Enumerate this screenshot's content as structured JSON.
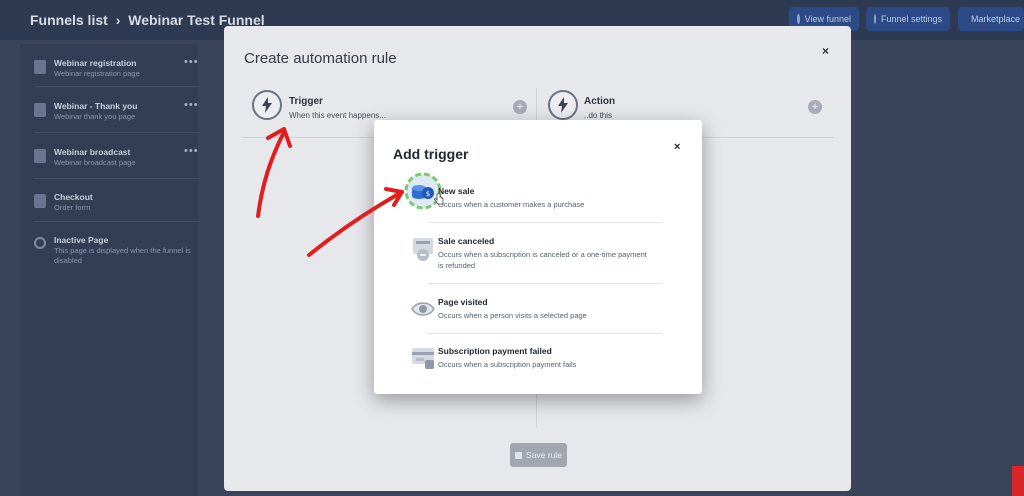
{
  "header": {
    "breadcrumb_root": "Funnels list",
    "separator": "›",
    "breadcrumb_current": "Webinar Test Funnel",
    "buttons": [
      {
        "label": "View funnel",
        "icon": "eye-icon"
      },
      {
        "label": "Funnel settings",
        "icon": "gear-icon"
      },
      {
        "label": "Marketplace",
        "icon": "store-icon"
      }
    ]
  },
  "sidebar": {
    "items": [
      {
        "title": "Webinar registration",
        "subtitle": "Webinar registration page",
        "icon": "page-icon"
      },
      {
        "title": "Webinar - Thank you",
        "subtitle": "Webinar thank you page",
        "icon": "page-icon"
      },
      {
        "title": "Webinar broadcast",
        "subtitle": "Webinar broadcast page",
        "icon": "page-icon"
      },
      {
        "title": "Checkout",
        "subtitle": "Order form",
        "icon": "cart-icon"
      },
      {
        "title": "Inactive Page",
        "subtitle": "This page is displayed when the funnel is disabled",
        "icon": "circle-icon"
      }
    ],
    "more_label": "•••"
  },
  "automation_modal": {
    "title": "Create automation rule",
    "close_label": "×",
    "trigger": {
      "label": "Trigger",
      "subtitle": "When this event happens..."
    },
    "action": {
      "label": "Action",
      "subtitle": "..do this"
    },
    "plus_label": "+",
    "save_label": "Save rule"
  },
  "trigger_modal": {
    "title": "Add trigger",
    "close_label": "×",
    "options": [
      {
        "title": "New sale",
        "description": "Occurs when a customer makes a purchase",
        "icon": "coins-icon"
      },
      {
        "title": "Sale canceled",
        "description": "Occurs when a subscription is canceled or a one-time payment is refunded",
        "icon": "refund-icon"
      },
      {
        "title": "Page visited",
        "description": "Occurs when a person visits a selected page",
        "icon": "eye-icon"
      },
      {
        "title": "Subscription payment failed",
        "description": "Occurs when a subscription payment fails",
        "icon": "failed-payment-icon"
      }
    ]
  },
  "colors": {
    "overlay": "#39445a",
    "annotation": "#e21d1d",
    "highlight": "#7bc96f"
  }
}
